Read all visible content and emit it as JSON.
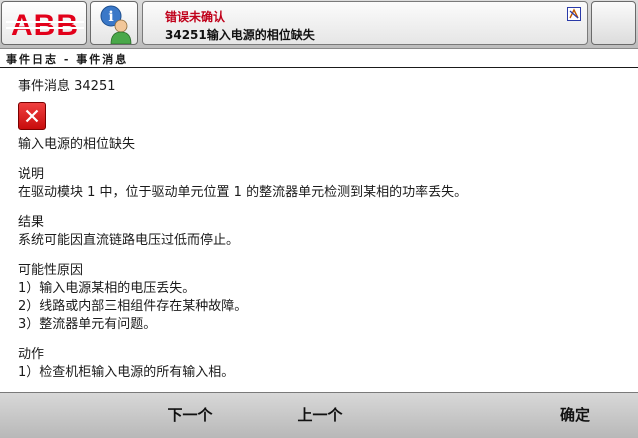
{
  "app": {
    "logo_text": "ABB"
  },
  "status_bar": {
    "title": "错误未确认",
    "message": "34251输入电源的相位缺失"
  },
  "breadcrumb": "事件日志 - 事件消息",
  "event": {
    "title": "事件消息 34251",
    "headline": "输入电源的相位缺失",
    "description_heading": "说明",
    "description": "在驱动模块 1 中，位于驱动单元位置 1 的整流器单元检测到某相的功率丢失。",
    "consequence_heading": "结果",
    "consequence": "系统可能因直流链路电压过低而停止。",
    "causes_heading": "可能性原因",
    "causes": [
      "1）输入电源某相的电压丢失。",
      "2）线路或内部三相组件存在某种故障。",
      "3）整流器单元有问题。"
    ],
    "actions_heading": "动作",
    "actions": [
      "1）检查机柜输入电源的所有输入相。"
    ]
  },
  "buttons": {
    "next": "下一个",
    "previous": "上一个",
    "ok": "确定"
  },
  "colors": {
    "status_title": "#c0001a",
    "abb_red": "#e2001a",
    "error_icon": "#d61414"
  },
  "icons": {
    "abb_logo": "abb-logo",
    "flexpendant_info": "info-person-icon",
    "status": "robot-status-icon",
    "error": "error-x-icon"
  }
}
